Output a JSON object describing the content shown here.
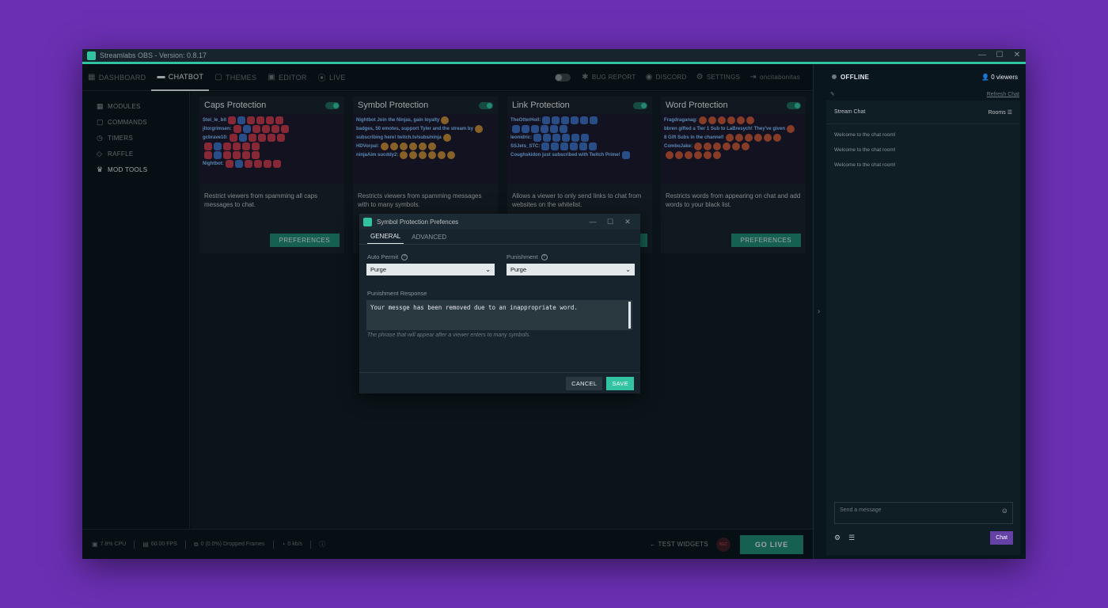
{
  "window": {
    "title": "Streamlabs OBS - Version: 0.8.17",
    "logo_text": "slobs",
    "controls": [
      "—",
      "☐",
      "✕"
    ]
  },
  "topnav": {
    "tabs": [
      {
        "label": "DASHBOARD",
        "icon": "dashboard-icon",
        "glyph": "▦",
        "active": false
      },
      {
        "label": "CHATBOT",
        "icon": "chatbot-icon",
        "glyph": "▬",
        "active": true
      },
      {
        "label": "THEMES",
        "icon": "themes-icon",
        "glyph": "▢",
        "active": false
      },
      {
        "label": "EDITOR",
        "icon": "editor-icon",
        "glyph": "▣",
        "active": false
      },
      {
        "label": "LIVE",
        "icon": "live-icon",
        "glyph": "⦿",
        "active": false
      }
    ],
    "right": [
      {
        "label": "BUG REPORT",
        "icon": "bug-icon",
        "glyph": "✱"
      },
      {
        "label": "DISCORD",
        "icon": "discord-icon",
        "glyph": "◉"
      },
      {
        "label": "SETTINGS",
        "icon": "gear-icon",
        "glyph": "⚙"
      },
      {
        "label": "oncitabonitas",
        "icon": "logout-icon",
        "glyph": "⇥"
      }
    ]
  },
  "sidebar": {
    "items": [
      {
        "label": "MODULES",
        "icon": "modules-icon",
        "glyph": "▦",
        "active": false
      },
      {
        "label": "COMMANDS",
        "icon": "commands-icon",
        "glyph": "▢",
        "active": false
      },
      {
        "label": "TIMERS",
        "icon": "timer-icon",
        "glyph": "◷",
        "active": false
      },
      {
        "label": "RAFFLE",
        "icon": "raffle-icon",
        "glyph": "◇",
        "active": false
      },
      {
        "label": "MOD TOOLS",
        "icon": "crown-icon",
        "glyph": "♛",
        "active": true
      }
    ]
  },
  "cards": [
    {
      "title": "Caps Protection",
      "desc": "Restrict viewers from spamming all caps messages to chat.",
      "button": "PREFERENCES",
      "preview": [
        "Stel_le_bit",
        "jltorgrimsen:",
        "gcbrave10:",
        "",
        "",
        "Nightbot:"
      ]
    },
    {
      "title": "Symbol Protection",
      "desc": "Restricts viewers from spamming messages with to many symbols.",
      "button": "PREFERENCES",
      "preview": [
        "Nightbot Join the Ninjas, gain loyalty",
        "badges, 50 emotes, support Tyler and the stream by",
        "subscribing here! twitch.tv/subs/ninja",
        "HDVorpal:",
        "ninjaAim  sucddy2:"
      ]
    },
    {
      "title": "Link Protection",
      "desc": "Allows a viewer to only send links to chat from websites on the whitelist.",
      "button": "PREFERENCES",
      "preview": [
        "TheOtterHoll:",
        "",
        "leonidric:",
        "SSJets_STC:",
        "Coughskidon just subscribed with Twitch Prime!"
      ]
    },
    {
      "title": "Word Protection",
      "desc": "Restricts words from appearing on chat and add words to your black list.",
      "button": "PREFERENCES",
      "preview": [
        "Fragdraganag:",
        "bbren gifted a Tier 1 Sub to LaBresych! They've given",
        "8 Gift Subs in the channel!",
        "ComboJake:",
        ""
      ]
    }
  ],
  "statusbar": {
    "cpu": "7.8% CPU",
    "fps": "60.00 FPS",
    "dropped": "0 (0.0%) Dropped Frames",
    "bandwidth": "0 kb/s",
    "test_widgets": "TEST WIDGETS",
    "rec": "REC",
    "go_live": "GO LIVE"
  },
  "chat": {
    "status": "OFFLINE",
    "viewers": "0 viewers",
    "refresh": "Refresh Chat",
    "title": "Stream Chat",
    "rooms": "Rooms",
    "messages": [
      "Welcome to the chat room!",
      "Welcome to the chat room!",
      "Welcome to the chat room!"
    ],
    "input_placeholder": "Send a message",
    "send_label": "Chat"
  },
  "modal": {
    "title": "Symbol Protection Prefences",
    "tabs": [
      {
        "label": "GENERAL",
        "active": true
      },
      {
        "label": "ADVANCED",
        "active": false
      }
    ],
    "auto_permit_label": "Auto Permit",
    "auto_permit_value": "Purge",
    "punishment_label": "Punishment",
    "punishment_value": "Purge",
    "response_label": "Punishment Response",
    "response_value": "Your messge has been removed due to an inappropriate word.",
    "hint": "The phrase that will appear after a viewer enters to many symbols.",
    "cancel": "CANCEL",
    "save": "SAVE"
  },
  "colors": {
    "accent": "#31c3a2",
    "background": "#09161d",
    "twitch_purple": "#6441a4"
  }
}
